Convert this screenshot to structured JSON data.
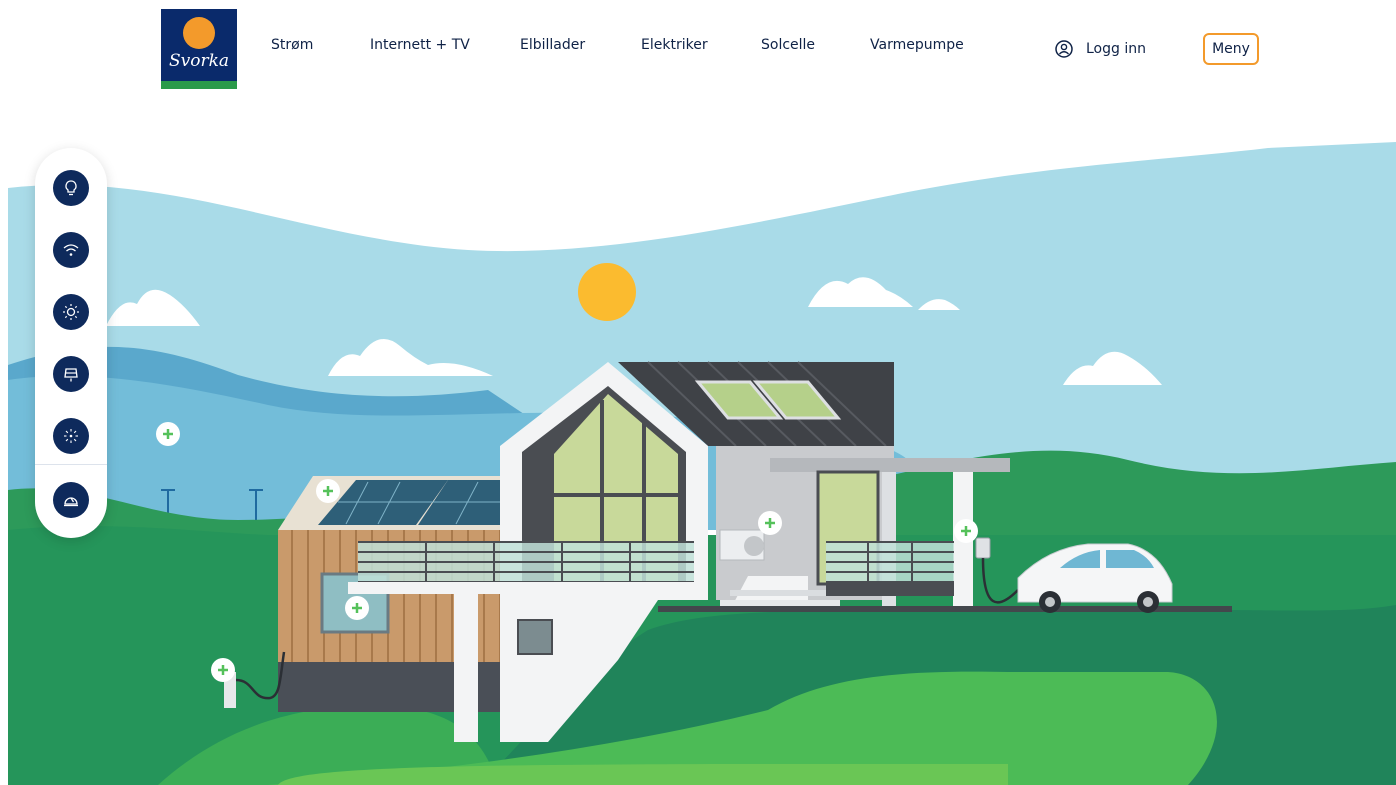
{
  "header": {
    "logo_text": "Svorka",
    "nav": [
      {
        "label": "Strøm"
      },
      {
        "label": "Internett + TV"
      },
      {
        "label": "Elbillader"
      },
      {
        "label": "Elektriker"
      },
      {
        "label": "Solcelle"
      },
      {
        "label": "Varmepumpe"
      }
    ],
    "login_label": "Logg inn",
    "menu_label": "Meny"
  },
  "side_rail": {
    "icons": [
      "lightbulb-icon",
      "wifi-icon",
      "sun-icon",
      "car-charger-icon",
      "heat-pump-icon",
      "electrician-icon"
    ]
  },
  "colors": {
    "brand_navy": "#0a2a6b",
    "brand_orange": "#f39a2b",
    "brand_green": "#2a9a4a",
    "hotspot_green": "#55c15a"
  }
}
